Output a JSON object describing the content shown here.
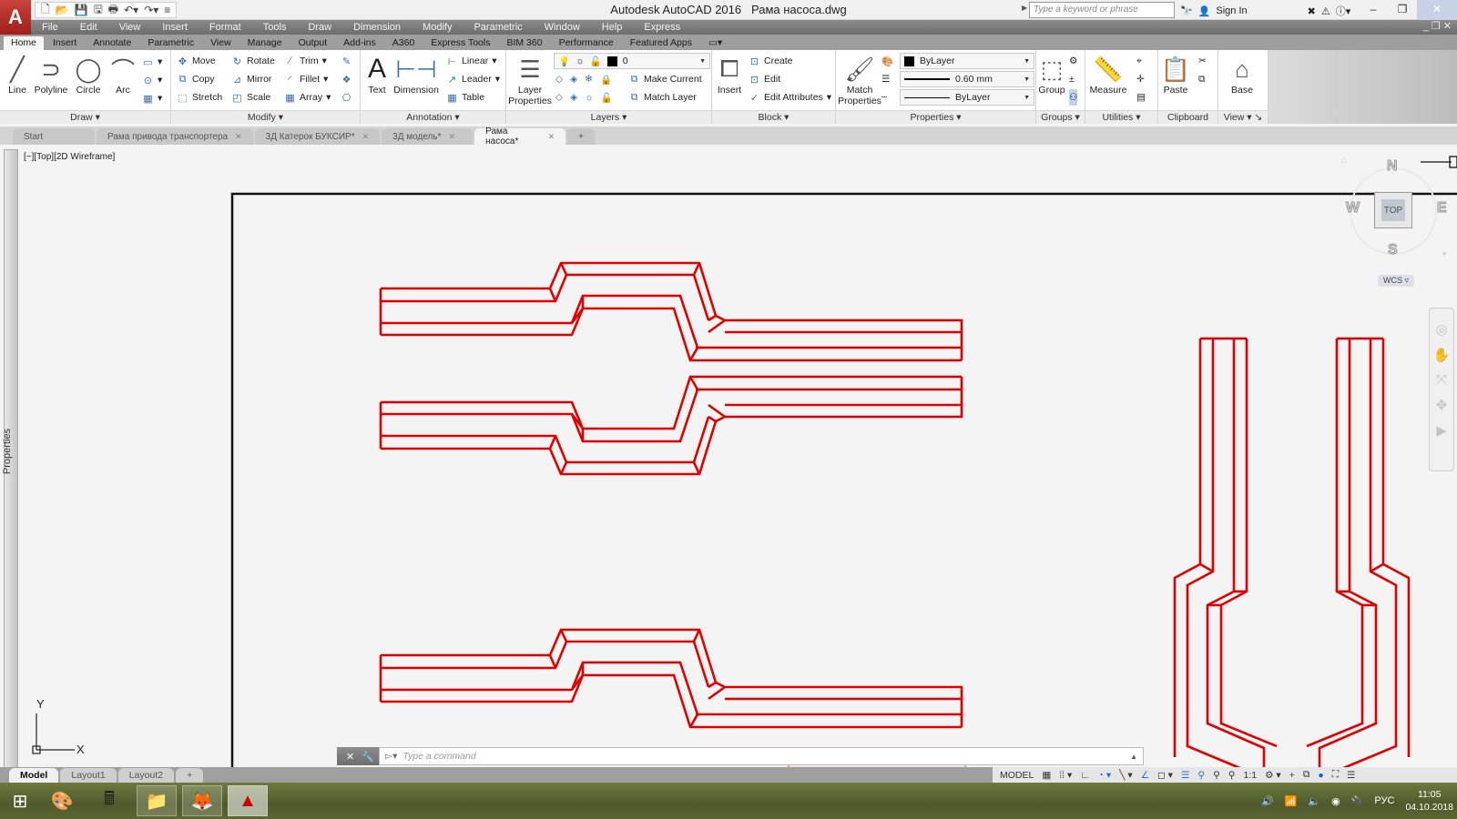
{
  "app": {
    "title": "Autodesk AutoCAD 2016",
    "document": "Рама насоса.dwg",
    "search_placeholder": "Type a keyword or phrase",
    "sign_in": "Sign In"
  },
  "menu": [
    "File",
    "Edit",
    "View",
    "Insert",
    "Format",
    "Tools",
    "Draw",
    "Dimension",
    "Modify",
    "Parametric",
    "Window",
    "Help",
    "Express"
  ],
  "ribbon_tabs": [
    "Home",
    "Insert",
    "Annotate",
    "Parametric",
    "View",
    "Manage",
    "Output",
    "Add-ins",
    "A360",
    "Express Tools",
    "BIM 360",
    "Performance",
    "Featured Apps"
  ],
  "active_ribbon_tab": "Home",
  "ribbon": {
    "draw": {
      "title": "Draw",
      "line": "Line",
      "polyline": "Polyline",
      "circle": "Circle",
      "arc": "Arc"
    },
    "modify": {
      "title": "Modify",
      "move": "Move",
      "rotate": "Rotate",
      "trim": "Trim",
      "copy": "Copy",
      "mirror": "Mirror",
      "fillet": "Fillet",
      "stretch": "Stretch",
      "scale": "Scale",
      "array": "Array"
    },
    "annotation": {
      "title": "Annotation",
      "text": "Text",
      "dimension": "Dimension",
      "linear": "Linear",
      "leader": "Leader",
      "table": "Table"
    },
    "layers": {
      "title": "Layers",
      "layer_properties_1": "Layer",
      "layer_properties_2": "Properties",
      "current_layer": "0",
      "make_current": "Make Current",
      "match_layer": "Match Layer"
    },
    "block": {
      "title": "Block",
      "insert": "Insert",
      "create": "Create",
      "edit": "Edit",
      "edit_attributes": "Edit Attributes"
    },
    "properties": {
      "title": "Properties",
      "match_1": "Match",
      "match_2": "Properties",
      "color": "ByLayer",
      "lineweight": "0.60 mm",
      "linetype": "ByLayer"
    },
    "groups": {
      "title": "Groups",
      "group": "Group"
    },
    "utilities": {
      "title": "Utilities",
      "measure": "Measure"
    },
    "clipboard": {
      "title": "Clipboard",
      "paste": "Paste"
    },
    "view": {
      "title": "View",
      "base": "Base"
    }
  },
  "doc_tabs": [
    {
      "label": "Start",
      "closable": false
    },
    {
      "label": "Рама привода транспортера",
      "closable": true
    },
    {
      "label": "3Д Катерок БУКСИР*",
      "closable": true
    },
    {
      "label": "3Д модель*",
      "closable": true
    },
    {
      "label": "Рама насоса*",
      "closable": true,
      "active": true
    }
  ],
  "viewport": {
    "controls": "[−][Top][2D Wireframe]",
    "properties_palette": "Properties",
    "viewcube": {
      "n": "N",
      "s": "S",
      "e": "E",
      "w": "W",
      "face": "TOP"
    },
    "wcs": "WCS",
    "ucs_x": "X",
    "ucs_y": "Y",
    "drawing_color": "#e00000"
  },
  "command_line": {
    "placeholder": "Type a command"
  },
  "layout_tabs": [
    {
      "label": "Model",
      "active": true
    },
    {
      "label": "Layout1"
    },
    {
      "label": "Layout2"
    }
  ],
  "status": {
    "mode": "MODEL",
    "scale": "1:1"
  },
  "taskbar": {
    "lang": "РУС",
    "time": "11:05",
    "date": "04.10.2018"
  }
}
